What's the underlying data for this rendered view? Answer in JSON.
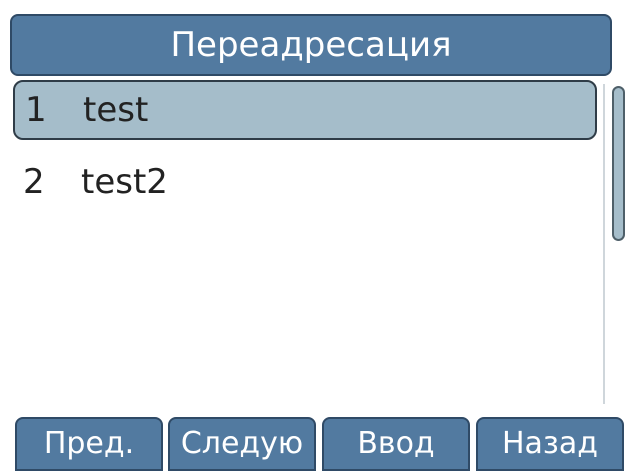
{
  "screen": {
    "title": "Переадресация"
  },
  "list": {
    "items": [
      {
        "number": "1",
        "label": "test",
        "selected": true
      },
      {
        "number": "2",
        "label": "test2",
        "selected": false
      }
    ]
  },
  "soft_keys": [
    {
      "label": "Пред."
    },
    {
      "label": "Следую"
    },
    {
      "label": "Ввод"
    },
    {
      "label": "Назад"
    }
  ],
  "colors": {
    "title_bar": "#527aa0",
    "selected_row": "#a5bdca",
    "soft_key": "#527aa0",
    "text": "#222222",
    "title_text": "#ffffff"
  }
}
